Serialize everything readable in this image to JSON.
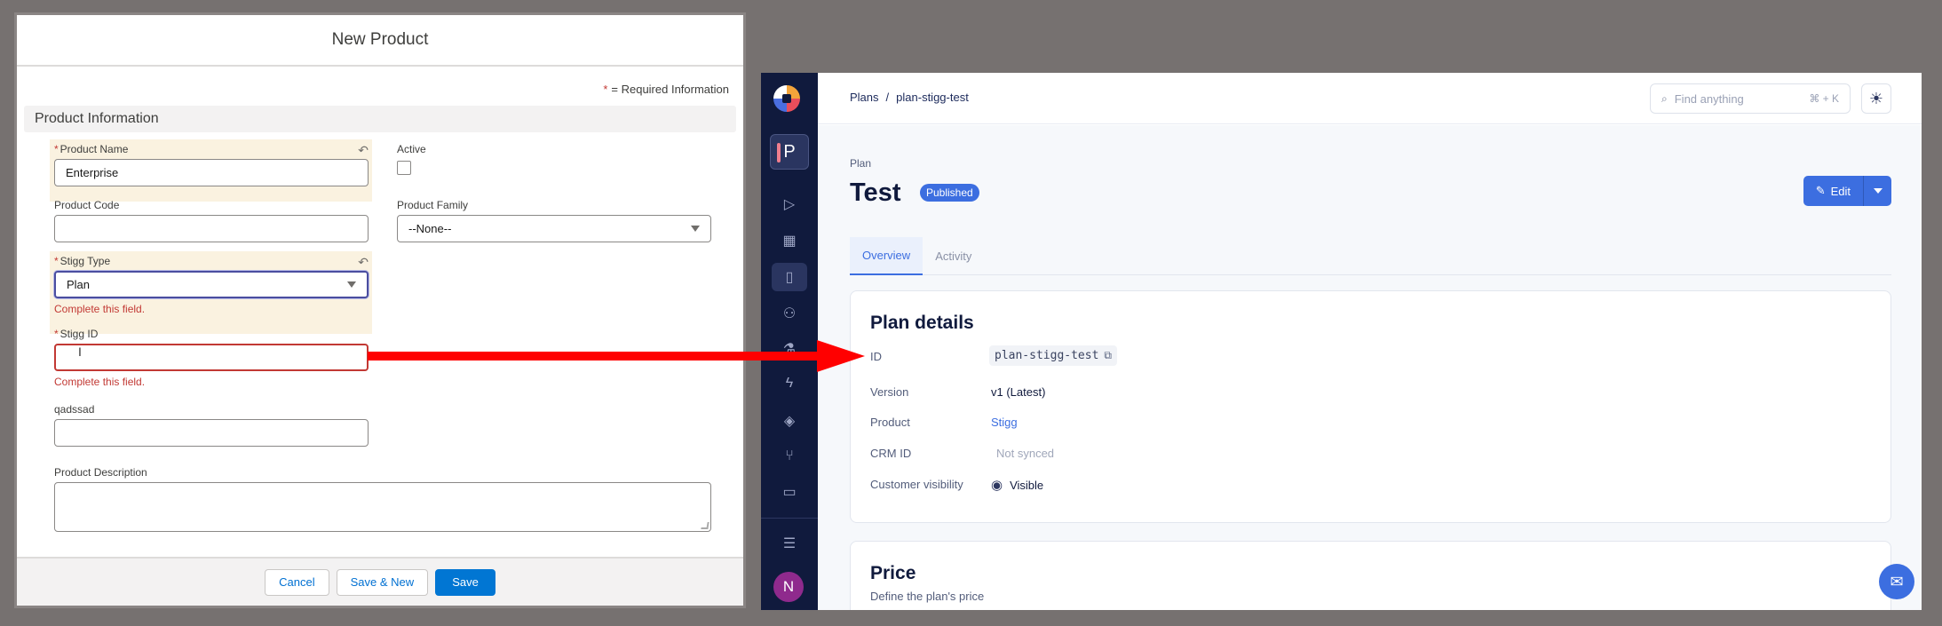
{
  "modal": {
    "title": "New Product",
    "required_star": "*",
    "required_text": "= Required Information",
    "section": "Product Information",
    "fields": {
      "product_name": {
        "label": "Product Name",
        "value": "Enterprise",
        "required": "*"
      },
      "active": {
        "label": "Active"
      },
      "product_code": {
        "label": "Product Code",
        "value": ""
      },
      "product_family": {
        "label": "Product Family",
        "value": "--None--"
      },
      "stigg_type": {
        "label": "Stigg Type",
        "value": "Plan",
        "required": "*",
        "error": "Complete this field."
      },
      "stigg_id": {
        "label": "Stigg ID",
        "value": "",
        "required": "*",
        "error": "Complete this field."
      },
      "qadssad": {
        "label": "qadssad",
        "value": ""
      },
      "product_description": {
        "label": "Product Description",
        "value": ""
      }
    },
    "buttons": {
      "cancel": "Cancel",
      "save_new": "Save & New",
      "save": "Save"
    }
  },
  "app": {
    "env_letter": "P",
    "avatar_letter": "N",
    "breadcrumb": {
      "root": "Plans",
      "sep": "/",
      "current": "plan-stigg-test"
    },
    "search": {
      "placeholder": "Find anything",
      "shortcut": "⌘ + K"
    },
    "plan": {
      "kicker": "Plan",
      "title": "Test",
      "status": "Published"
    },
    "edit_label": "Edit",
    "tabs": [
      "Overview",
      "Activity"
    ],
    "details": {
      "title": "Plan details",
      "rows": {
        "id": {
          "label": "ID",
          "value": "plan-stigg-test"
        },
        "version": {
          "label": "Version",
          "value": "v1 (Latest)"
        },
        "product": {
          "label": "Product",
          "value": "Stigg"
        },
        "crm": {
          "label": "CRM ID",
          "value": "Not synced"
        },
        "visibility": {
          "label": "Customer visibility",
          "value": "Visible"
        }
      }
    },
    "price": {
      "title": "Price",
      "subtitle": "Define the plan's price"
    }
  },
  "colors": {
    "arrow": "#ff0000",
    "brand": "#0176d3",
    "stigg_primary": "#3c6ee0",
    "sidebar": "#101a3d",
    "error": "#c23934"
  },
  "icons": [
    "undo-icon",
    "search-icon",
    "sun-icon",
    "pencil-icon",
    "copy-icon",
    "eye-icon",
    "chat-icon"
  ]
}
